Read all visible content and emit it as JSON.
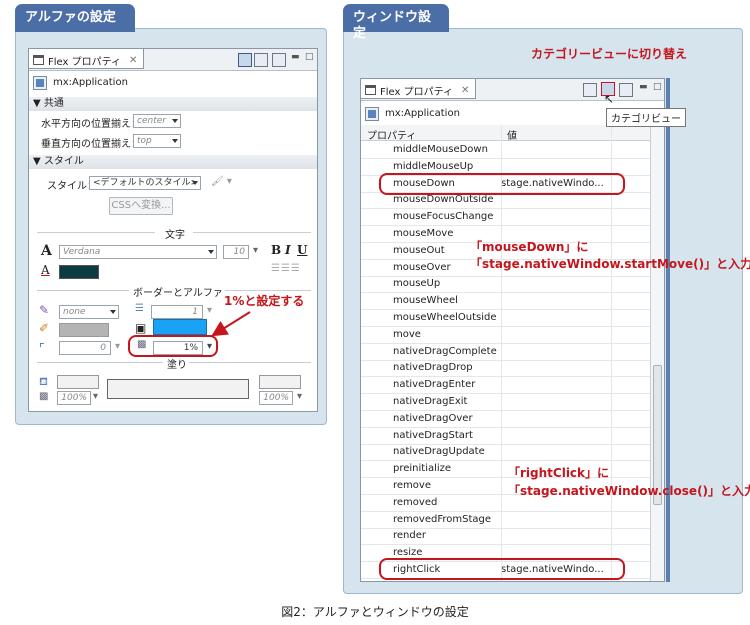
{
  "left": {
    "section_title": "アルファの設定",
    "panel_tab": "Flex プロパティ",
    "app_name": "mx:Application",
    "common": {
      "header": "共通",
      "h_align_label": "水平方向の位置揃え：",
      "h_align_value": "center",
      "v_align_label": "垂直方向の位置揃え：",
      "v_align_value": "top"
    },
    "style": {
      "header": "スタイル",
      "style_label": "スタイル：",
      "style_value": "<デフォルトのスタイル>",
      "css_button": "CSSへ変換..."
    },
    "text": {
      "header": "文字",
      "font": "Verdana",
      "size": "10",
      "bold": "B",
      "italic": "I",
      "underline": "U",
      "letter_a": "A",
      "letter_a2": "A",
      "color": "#0d3b44"
    },
    "border": {
      "header": "ボーダーとアルファ",
      "border_style": "none",
      "border_thickness": "1",
      "corner_radius": "0",
      "alpha": "1%",
      "swatch_gray": "#b4b4b4",
      "swatch_blue": "#1aa3f5"
    },
    "fill": {
      "header": "塗り",
      "left_alpha": "100%",
      "right_alpha": "100%"
    },
    "annotation": "1%と設定する"
  },
  "right": {
    "section_title": "ウィンドウ設定",
    "panel_tab": "Flex プロパティ",
    "app_name": "mx:Application",
    "col_property": "プロパティ",
    "col_value": "値",
    "tooltip": "カテゴリビュー",
    "annotation_top": "カテゴリービューに切り替え",
    "annotation_mid_1": "「mouseDown」に",
    "annotation_mid_2": "「stage.nativeWindow.startMove()」と入力",
    "annotation_bot_1": "「rightClick」に",
    "annotation_bot_2": "「stage.nativeWindow.close()」と入力",
    "rows": [
      {
        "name": "middleMouseDown",
        "value": ""
      },
      {
        "name": "middleMouseUp",
        "value": ""
      },
      {
        "name": "mouseDown",
        "value": "stage.nativeWindo..."
      },
      {
        "name": "mouseDownOutside",
        "value": ""
      },
      {
        "name": "mouseFocusChange",
        "value": ""
      },
      {
        "name": "mouseMove",
        "value": ""
      },
      {
        "name": "mouseOut",
        "value": ""
      },
      {
        "name": "mouseOver",
        "value": ""
      },
      {
        "name": "mouseUp",
        "value": ""
      },
      {
        "name": "mouseWheel",
        "value": ""
      },
      {
        "name": "mouseWheelOutside",
        "value": ""
      },
      {
        "name": "move",
        "value": ""
      },
      {
        "name": "nativeDragComplete",
        "value": ""
      },
      {
        "name": "nativeDragDrop",
        "value": ""
      },
      {
        "name": "nativeDragEnter",
        "value": ""
      },
      {
        "name": "nativeDragExit",
        "value": ""
      },
      {
        "name": "nativeDragOver",
        "value": ""
      },
      {
        "name": "nativeDragStart",
        "value": ""
      },
      {
        "name": "nativeDragUpdate",
        "value": ""
      },
      {
        "name": "preinitialize",
        "value": ""
      },
      {
        "name": "remove",
        "value": ""
      },
      {
        "name": "removed",
        "value": ""
      },
      {
        "name": "removedFromStage",
        "value": ""
      },
      {
        "name": "render",
        "value": ""
      },
      {
        "name": "resize",
        "value": ""
      },
      {
        "name": "rightClick",
        "value": "stage.nativeWindo..."
      }
    ]
  },
  "caption": "図2：アルファとウィンドウの設定",
  "colors": {
    "accent_red": "#c4161c",
    "section_tab": "#4a6ea5",
    "outer_bg": "#d6e4ee"
  }
}
